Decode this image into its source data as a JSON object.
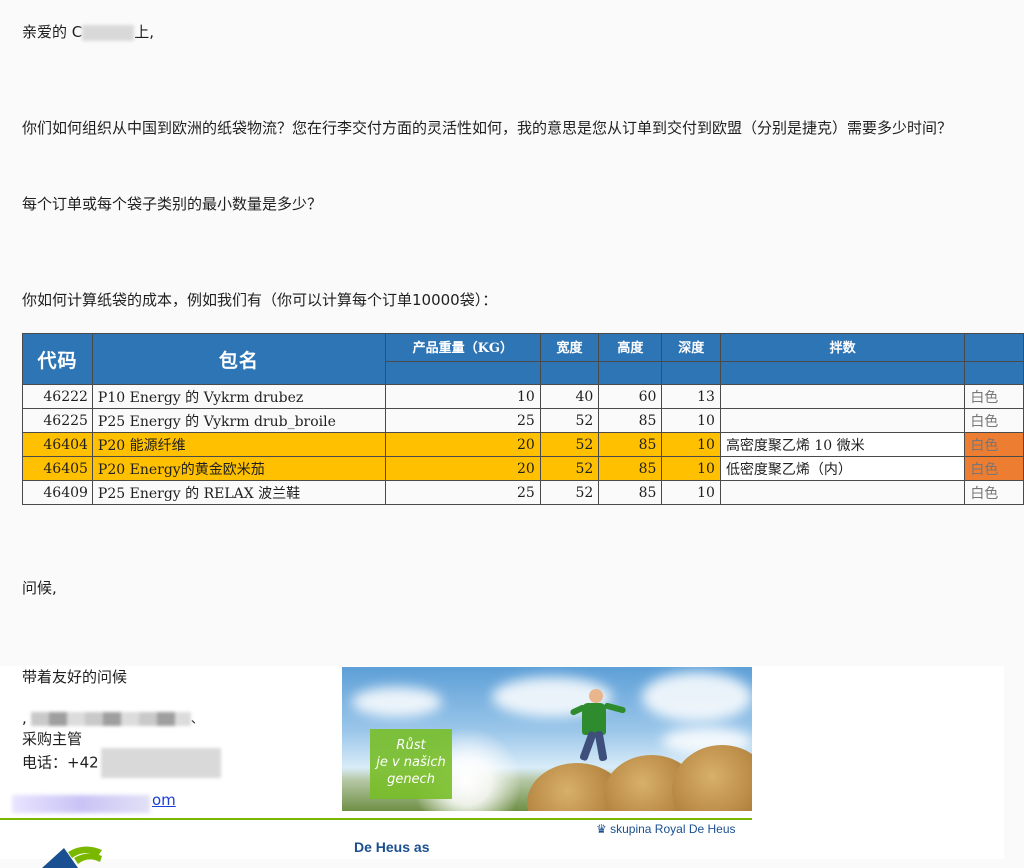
{
  "greeting": {
    "prefix": "亲爱的 C",
    "suffix": "上,"
  },
  "paragraph1": "你们如何组织从中国到欧洲的纸袋物流？您在行李交付方面的灵活性如何，我的意思是您从订单到交付到欧盟（分别是捷克）需要多少时间？",
  "paragraph2": "每个订单或每个袋子类别的最小数量是多少？",
  "paragraph3": "你如何计算纸袋的成本，例如我们有（你可以计算每个订单10000袋）：",
  "table": {
    "headers": {
      "code": "代码",
      "name": "包名",
      "weight": "产品重量（KG）",
      "width": "宽度",
      "height": "高度",
      "depth": "深度",
      "layers": "拌数"
    },
    "rows": [
      {
        "code": "46222",
        "name": "P10 Energy 的 Vykrm drubez",
        "weight": "10",
        "width": "40",
        "height": "60",
        "depth": "13",
        "layers": "",
        "color": "白色",
        "highlight": false
      },
      {
        "code": "46225",
        "name": "P25 Energy 的 Vykrm drub_broile",
        "weight": "25",
        "width": "52",
        "height": "85",
        "depth": "10",
        "layers": "",
        "color": "白色",
        "highlight": false
      },
      {
        "code": "46404",
        "name": "P20 能源纤维",
        "weight": "20",
        "width": "52",
        "height": "85",
        "depth": "10",
        "layers": "高密度聚乙烯 10 微米",
        "color": "白色",
        "highlight": true
      },
      {
        "code": "46405",
        "name": "P20 Energy的黄金欧米茄",
        "weight": "20",
        "width": "52",
        "height": "85",
        "depth": "10",
        "layers": "低密度聚乙烯（内）",
        "color": "白色",
        "highlight": true
      },
      {
        "code": "46409",
        "name": "P25 Energy 的 RELAX 波兰鞋",
        "weight": "25",
        "width": "52",
        "height": "85",
        "depth": "10",
        "layers": "",
        "color": "白色",
        "highlight": false
      }
    ],
    "colors": {
      "header": "#2e75b6",
      "highlight": "#ffc000",
      "highlight_last": "#ed7d31"
    }
  },
  "closing": "问候,",
  "signature": {
    "line1": "带着友好的问候",
    "title": "采购主管",
    "phone_label": "电话：+42",
    "email_tail": "om",
    "banner_text": [
      "Růst",
      "je v našich",
      "genech"
    ],
    "group_text": "skupina Royal De Heus",
    "company": "De Heus as",
    "brand_color": "#1a4f91",
    "accent_color": "#7ab800"
  }
}
